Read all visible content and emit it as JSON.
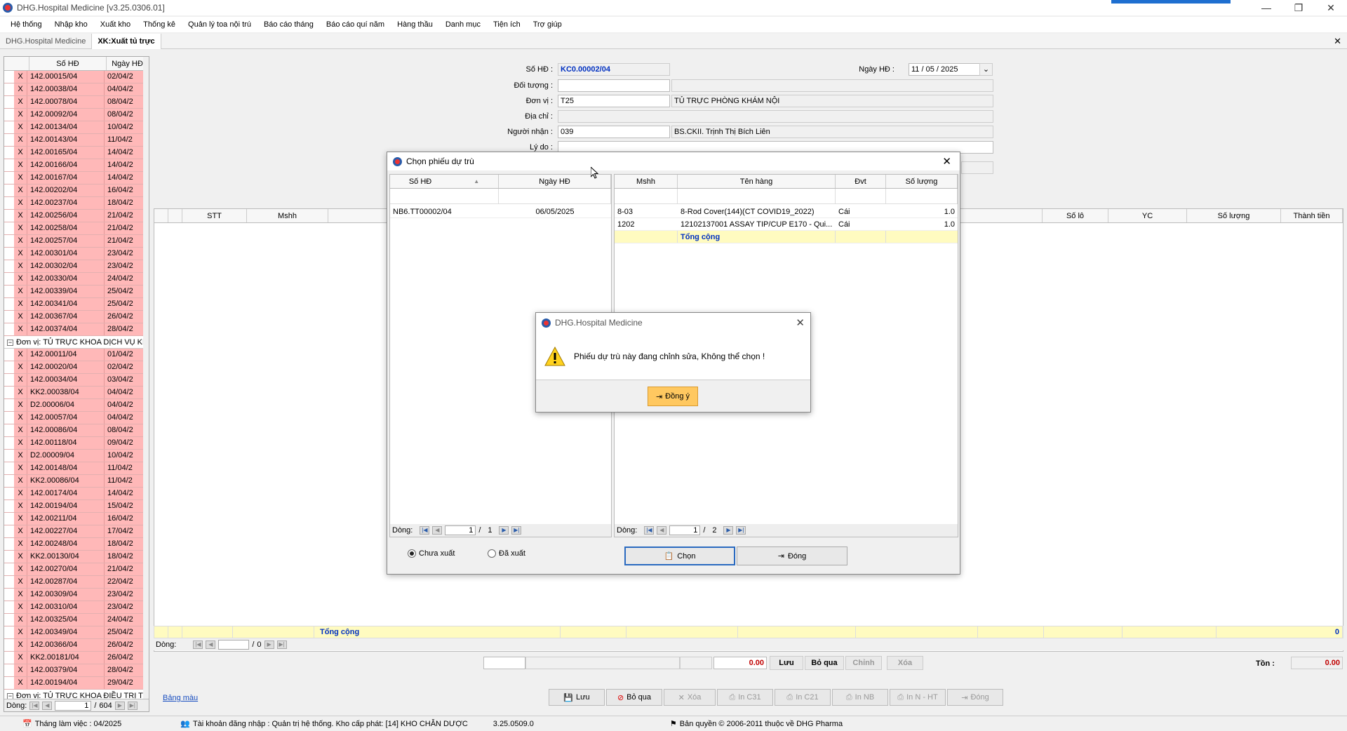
{
  "window": {
    "title": "DHG.Hospital Medicine [v3.25.0306.01]"
  },
  "menu": [
    "Hệ thống",
    "Nhập kho",
    "Xuất kho",
    "Thống kê",
    "Quản lý toa nội trú",
    "Báo cáo tháng",
    "Báo cáo quí năm",
    "Hàng thầu",
    "Danh mục",
    "Tiện ích",
    "Trợ giúp"
  ],
  "tabs": [
    {
      "label": "DHG.Hospital Medicine",
      "active": false
    },
    {
      "label": "XK:Xuất tủ trực",
      "active": true
    }
  ],
  "left_list": {
    "headers": [
      "Số HĐ",
      "Ngày HĐ"
    ],
    "rows_a": [
      [
        "X",
        "142.00015/04",
        "02/04/2"
      ],
      [
        "X",
        "142.00038/04",
        "04/04/2"
      ],
      [
        "X",
        "142.00078/04",
        "08/04/2"
      ],
      [
        "X",
        "142.00092/04",
        "08/04/2"
      ],
      [
        "X",
        "142.00134/04",
        "10/04/2"
      ],
      [
        "X",
        "142.00143/04",
        "11/04/2"
      ],
      [
        "X",
        "142.00165/04",
        "14/04/2"
      ],
      [
        "X",
        "142.00166/04",
        "14/04/2"
      ],
      [
        "X",
        "142.00167/04",
        "14/04/2"
      ],
      [
        "X",
        "142.00202/04",
        "16/04/2"
      ],
      [
        "X",
        "142.00237/04",
        "18/04/2"
      ],
      [
        "X",
        "142.00256/04",
        "21/04/2"
      ],
      [
        "X",
        "142.00258/04",
        "21/04/2"
      ],
      [
        "X",
        "142.00257/04",
        "21/04/2"
      ],
      [
        "X",
        "142.00301/04",
        "23/04/2"
      ],
      [
        "X",
        "142.00302/04",
        "23/04/2"
      ],
      [
        "X",
        "142.00330/04",
        "24/04/2"
      ],
      [
        "X",
        "142.00339/04",
        "25/04/2"
      ],
      [
        "X",
        "142.00341/04",
        "25/04/2"
      ],
      [
        "X",
        "142.00367/04",
        "26/04/2"
      ],
      [
        "X",
        "142.00374/04",
        "28/04/2"
      ]
    ],
    "group_b": "Đơn vị:  TỦ TRỰC KHOA DỊCH VỤ KH",
    "rows_b": [
      [
        "X",
        "142.00011/04",
        "01/04/2"
      ],
      [
        "X",
        "142.00020/04",
        "02/04/2"
      ],
      [
        "X",
        "142.00034/04",
        "03/04/2"
      ],
      [
        "X",
        "KK2.00038/04",
        "04/04/2"
      ],
      [
        "X",
        "D2.00006/04",
        "04/04/2"
      ],
      [
        "X",
        "142.00057/04",
        "04/04/2"
      ],
      [
        "X",
        "142.00086/04",
        "08/04/2"
      ],
      [
        "X",
        "142.00118/04",
        "09/04/2"
      ],
      [
        "X",
        "D2.00009/04",
        "10/04/2"
      ],
      [
        "X",
        "142.00148/04",
        "11/04/2"
      ],
      [
        "X",
        "KK2.00086/04",
        "11/04/2"
      ],
      [
        "X",
        "142.00174/04",
        "14/04/2"
      ],
      [
        "X",
        "142.00194/04",
        "15/04/2"
      ],
      [
        "X",
        "142.00211/04",
        "16/04/2"
      ],
      [
        "X",
        "142.00227/04",
        "17/04/2"
      ],
      [
        "X",
        "142.00248/04",
        "18/04/2"
      ],
      [
        "X",
        "KK2.00130/04",
        "18/04/2"
      ],
      [
        "X",
        "142.00270/04",
        "21/04/2"
      ],
      [
        "X",
        "142.00287/04",
        "22/04/2"
      ],
      [
        "X",
        "142.00309/04",
        "23/04/2"
      ],
      [
        "X",
        "142.00310/04",
        "23/04/2"
      ],
      [
        "X",
        "142.00325/04",
        "24/04/2"
      ],
      [
        "X",
        "142.00349/04",
        "25/04/2"
      ],
      [
        "X",
        "142.00366/04",
        "26/04/2"
      ],
      [
        "X",
        "KK2.00181/04",
        "26/04/2"
      ],
      [
        "X",
        "142.00379/04",
        "28/04/2"
      ],
      [
        "X",
        "142.00194/04",
        "29/04/2"
      ]
    ],
    "group_c": "Đơn vị:  TỦ TRỰC KHOA ĐIỀU TRỊ T",
    "footer": {
      "label": "Dòng:",
      "current": "1",
      "total": "604"
    }
  },
  "form": {
    "so_hd_label": "Số HĐ :",
    "so_hd": "KC0.00002/04",
    "ngay_hd_label": "Ngày HĐ :",
    "ngay_hd": "11 / 05 / 2025",
    "doi_tuong_label": "Đối tượng :",
    "don_vi_label": "Đơn vị :",
    "don_vi_code": "T25",
    "don_vi_name": "TỦ TRỰC PHÒNG KHÁM NỘI",
    "dia_chi_label": "Địa chỉ :",
    "nguoi_nhan_label": "Người nhận :",
    "nguoi_nhan_code": "039",
    "nguoi_nhan_name": "BS.CKII. Trịnh Thị Bích Liên",
    "ly_do_label": "Lý do :"
  },
  "main_grid": {
    "headers_left": [
      "STT",
      "Mshh"
    ],
    "headers_right": [
      "Số lô",
      "YC",
      "Số lượng",
      "Thành tiền"
    ],
    "total_label": "Tổng cộng",
    "total_value": "0",
    "footer": {
      "label": "Dòng:",
      "current": "",
      "total": "0"
    }
  },
  "summary_bar": {
    "amount": "0.00",
    "luu": "Lưu",
    "bo_qua": "Bỏ qua",
    "chinh": "Chỉnh",
    "xoa": "Xóa",
    "ton_label": "Tồn :",
    "ton_value": "0.00"
  },
  "bottom_buttons": [
    "Lưu",
    "Bỏ qua",
    "Xóa",
    "In C31",
    "In C21",
    "In NB",
    "In N - HT",
    "Đóng"
  ],
  "bang_mau": "Bảng màu",
  "status": {
    "thang": "Tháng làm việc : 04/2025",
    "tai_khoan": "Tài khoản đăng nhập : Quản trị hệ thống. Kho cấp phát: [14] KHO CHẴN DƯỢC",
    "version": "3.25.0509.0",
    "copyright": "Bản quyền © 2006-2011 thuộc về DHG Pharma"
  },
  "dialog": {
    "title": "Chọn phiếu dự trù",
    "left_headers": [
      "Số HĐ",
      "Ngày HĐ"
    ],
    "left_rows": [
      [
        "NB6.TT00002/04",
        "06/05/2025"
      ]
    ],
    "left_footer": {
      "label": "Dòng:",
      "current": "1",
      "total": "1"
    },
    "right_headers": [
      "Mshh",
      "Tên hàng",
      "Đvt",
      "Số lượng"
    ],
    "right_rows": [
      [
        "8-03",
        "8-Rod Cover(144)(CT COVID19_2022)",
        "Cái",
        "1.0"
      ],
      [
        "1202",
        "12102137001 ASSAY TIP/CUP E170  - Qui...",
        "Cái",
        "1.0"
      ]
    ],
    "right_total": "Tổng cộng",
    "right_footer": {
      "label": "Dòng:",
      "current": "1",
      "total": "2"
    },
    "radio_chua": "Chưa xuất",
    "radio_da": "Đã xuất",
    "btn_chon": "Chọn",
    "btn_dong": "Đóng"
  },
  "message": {
    "title": "DHG.Hospital Medicine",
    "text": "Phiếu dự trù này đang chỉnh sửa, Không thể chọn !",
    "ok": "Đồng ý"
  }
}
